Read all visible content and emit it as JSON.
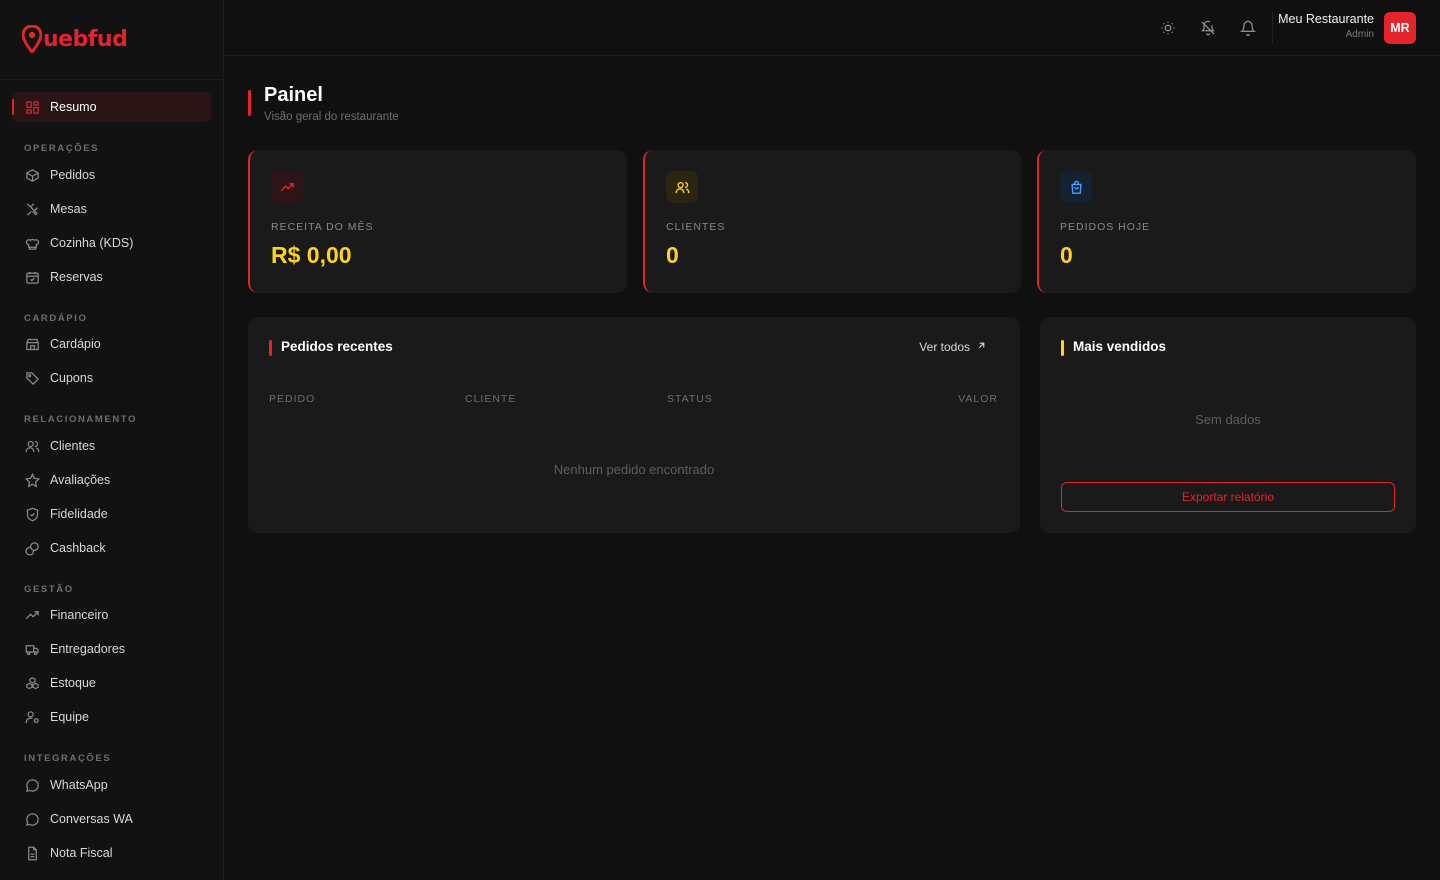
{
  "brand": {
    "logo_text": "uebfud",
    "accent_color": "#e3242b",
    "value_color": "#ffd21f"
  },
  "sidebar": {
    "active": {
      "label": "Resumo",
      "icon": "grid-icon"
    },
    "sections": [
      {
        "label": "OPERAÇÕES",
        "items": [
          {
            "label": "Pedidos",
            "icon": "package-icon"
          },
          {
            "label": "Mesas",
            "icon": "utensils-icon"
          },
          {
            "label": "Cozinha (KDS)",
            "icon": "chef-hat-icon"
          },
          {
            "label": "Reservas",
            "icon": "calendar-check-icon"
          }
        ]
      },
      {
        "label": "CARDÁPIO",
        "items": [
          {
            "label": "Cardápio",
            "icon": "store-icon"
          },
          {
            "label": "Cupons",
            "icon": "tag-icon"
          }
        ]
      },
      {
        "label": "RELACIONAMENTO",
        "items": [
          {
            "label": "Clientes",
            "icon": "users-icon"
          },
          {
            "label": "Avaliações",
            "icon": "star-icon"
          },
          {
            "label": "Fidelidade",
            "icon": "shield-check-icon"
          },
          {
            "label": "Cashback",
            "icon": "coins-icon"
          }
        ]
      },
      {
        "label": "GESTÃO",
        "items": [
          {
            "label": "Financeiro",
            "icon": "trending-up-icon"
          },
          {
            "label": "Entregadores",
            "icon": "truck-icon"
          },
          {
            "label": "Estoque",
            "icon": "boxes-icon"
          },
          {
            "label": "Equipe",
            "icon": "user-cog-icon"
          }
        ]
      },
      {
        "label": "INTEGRAÇÕES",
        "items": [
          {
            "label": "WhatsApp",
            "icon": "message-circle-icon"
          },
          {
            "label": "Conversas WA",
            "icon": "message-circle-icon"
          },
          {
            "label": "Nota Fiscal",
            "icon": "file-text-icon"
          }
        ]
      }
    ]
  },
  "header": {
    "icons": [
      "sun-icon",
      "bell-off-icon",
      "bell-icon"
    ],
    "user_name": "Meu Restaurante",
    "user_role": "Admin",
    "avatar_initials": "MR"
  },
  "page": {
    "title": "Painel",
    "subtitle": "Visão geral do restaurante"
  },
  "stats": [
    {
      "label": "RECEITA DO MÊS",
      "value": "R$ 0,00",
      "icon": "trending-up-icon",
      "icon_color": "#e3242b"
    },
    {
      "label": "CLIENTES",
      "value": "0",
      "icon": "users-icon",
      "icon_color": "#ffd21f"
    },
    {
      "label": "PEDIDOS HOJE",
      "value": "0",
      "icon": "shopping-bag-icon",
      "icon_color": "#4a9eff"
    }
  ],
  "recent_orders": {
    "title": "Pedidos recentes",
    "view_all": "Ver todos",
    "columns": [
      "PEDIDO",
      "CLIENTE",
      "STATUS",
      "VALOR"
    ],
    "empty": "Nenhum pedido encontrado",
    "rows": []
  },
  "best_sellers": {
    "title": "Mais vendidos",
    "empty": "Sem dados",
    "export_label": "Exportar relatório"
  }
}
